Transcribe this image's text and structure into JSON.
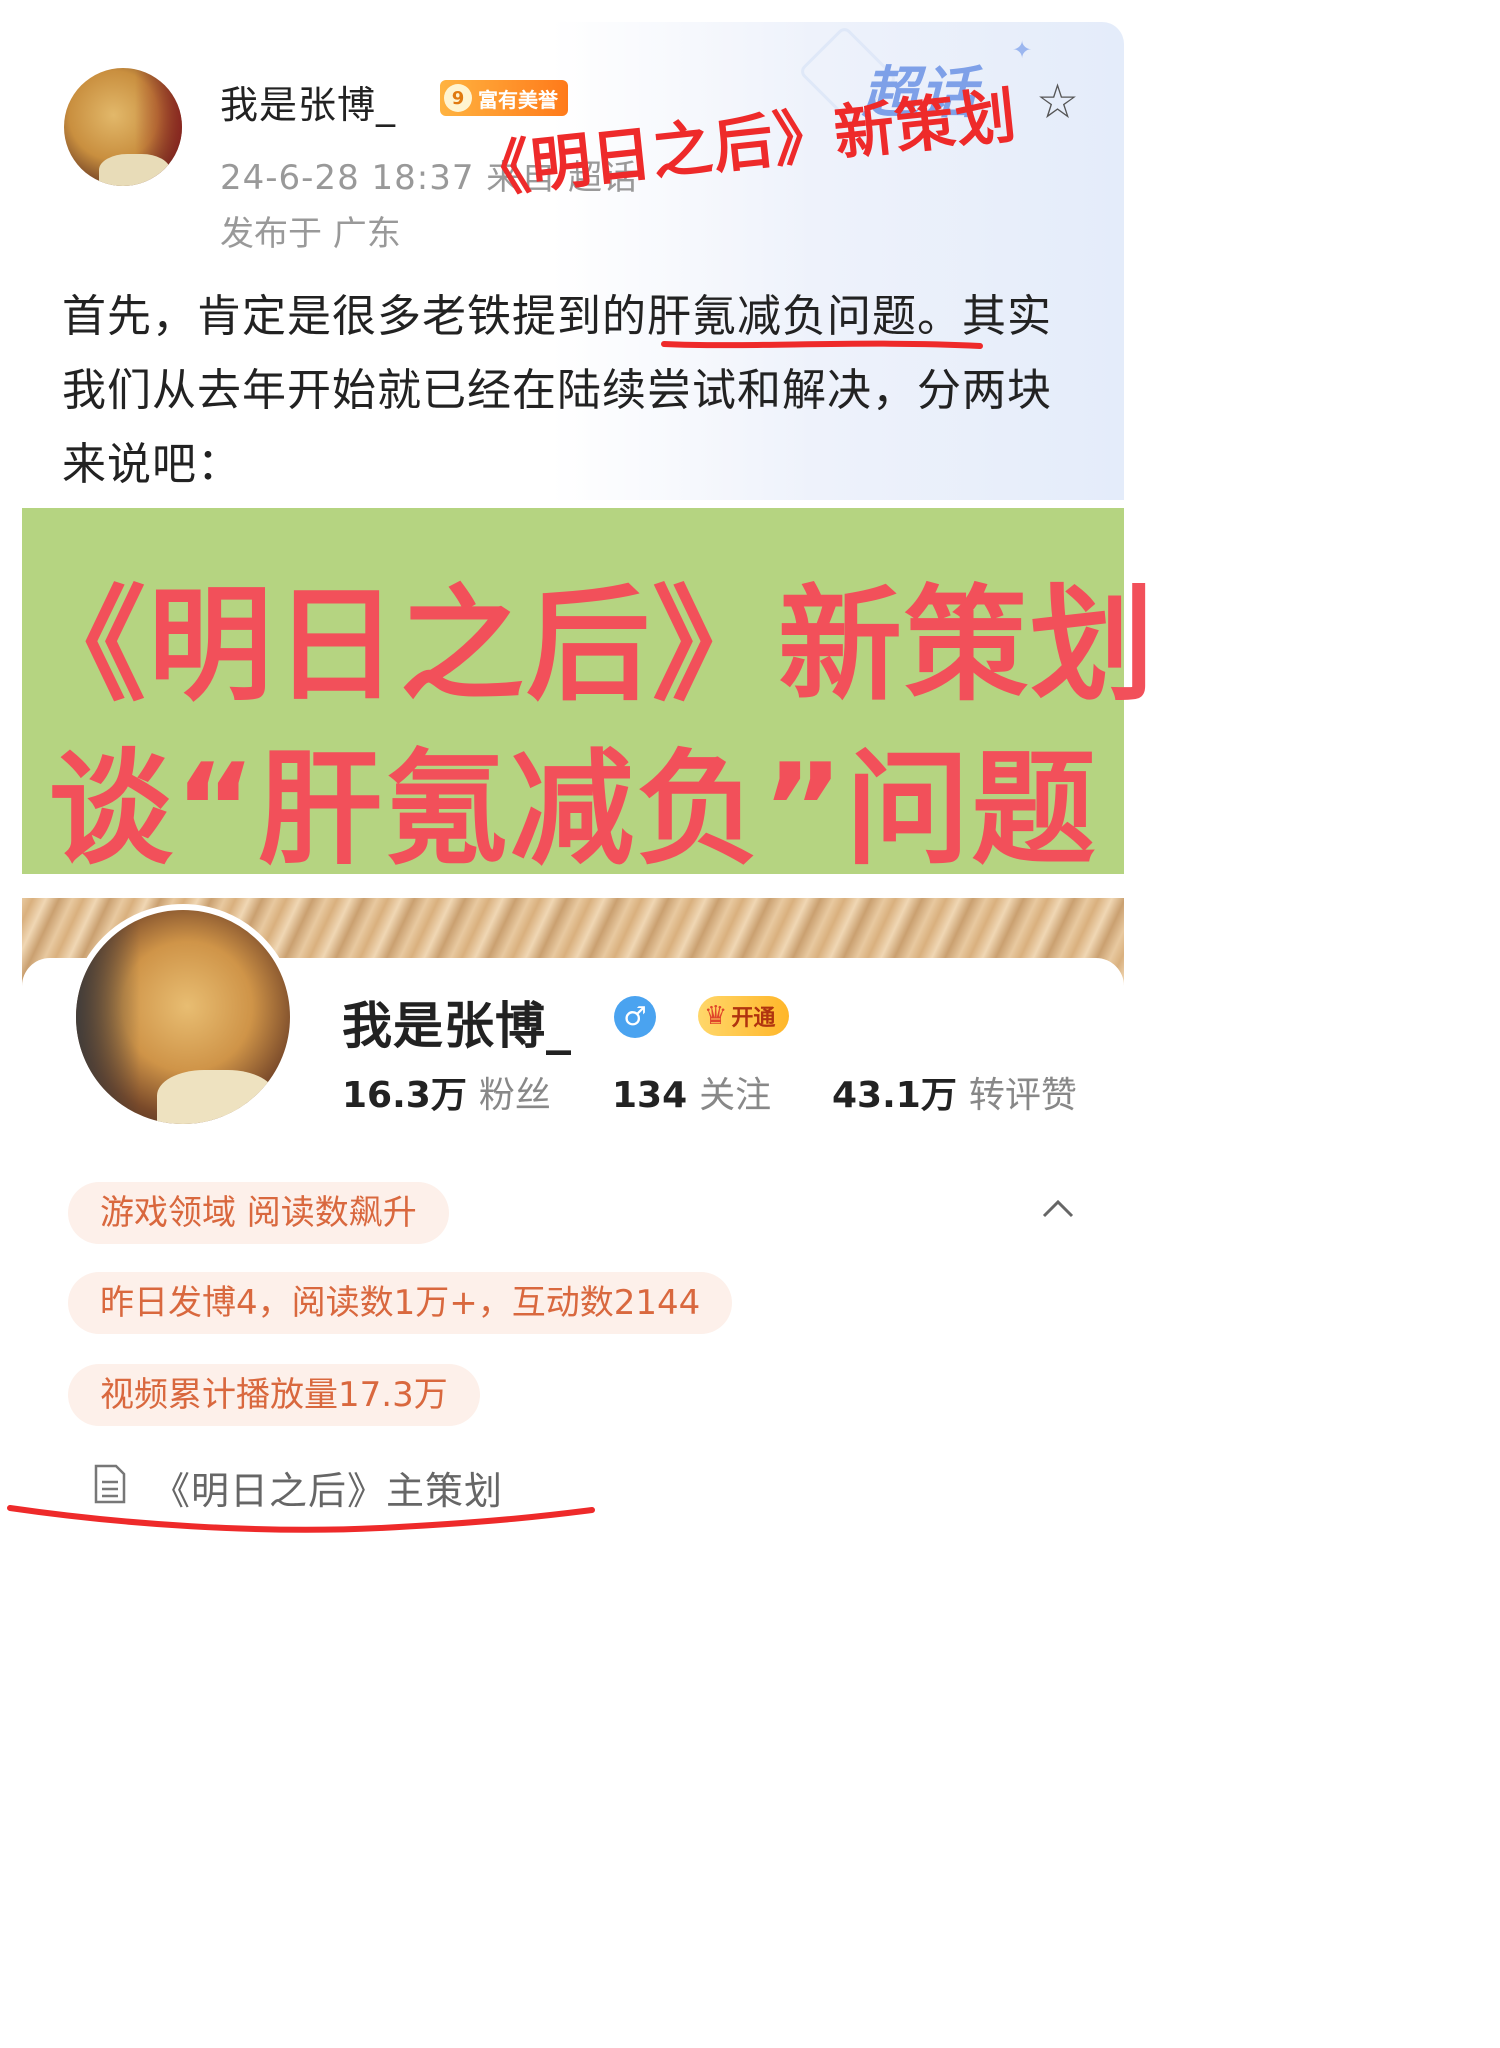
{
  "post": {
    "username": "我是张博_",
    "honor_level": "9",
    "honor_label": "富有美誉",
    "time_source": "24-6-28 18:37  来自 超话",
    "location": "发布于 广东",
    "supertopic_label": "超话",
    "overlay_title": "《明日之后》新策划",
    "body_before": "首先，肯定是很多老铁提到的",
    "body_highlight": "肝氪减负问题",
    "body_after": "。其实我们从去年开始就已经在陆续尝试和解决，分两块来说吧："
  },
  "banner": {
    "line1": "《明日之后》新策划",
    "line2": "谈“肝氪减负”问题"
  },
  "profile": {
    "username": "我是张博_",
    "gender_symbol": "♂",
    "vip_label": "开通",
    "stats": [
      {
        "num": "16.3万",
        "label": "粉丝"
      },
      {
        "num": "134",
        "label": "关注"
      },
      {
        "num": "43.1万",
        "label": "转评赞"
      }
    ],
    "tags": [
      "游戏领域 阅读数飙升",
      "昨日发博4，阅读数1万+，互动数2144",
      "视频累计播放量17.3万"
    ],
    "description": "《明日之后》主策划"
  },
  "colors": {
    "banner_bg": "#b5d481",
    "banner_text": "#f2505a",
    "annotation_red": "#ee2a2a",
    "tag_bg": "#fdf0ea",
    "tag_text": "#d9683e"
  },
  "icons": [
    "star-icon",
    "male-icon",
    "crown-icon",
    "chevron-up-icon",
    "document-icon"
  ]
}
